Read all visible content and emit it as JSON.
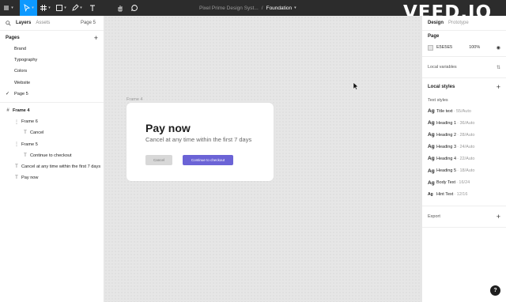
{
  "toolbar": {
    "breadcrumb_project": "Pixel Prime Design Syst...",
    "breadcrumb_separator": "/",
    "breadcrumb_page": "Foundation",
    "watermark": "VEED.IO"
  },
  "left_panel": {
    "tabs": {
      "layers": "Layers",
      "assets": "Assets"
    },
    "current_page": "Page 5",
    "pages_heading": "Pages",
    "pages": [
      {
        "label": "Brand"
      },
      {
        "label": "Typography"
      },
      {
        "label": "Colors"
      },
      {
        "label": "Website"
      },
      {
        "label": "Page 5",
        "current": true
      }
    ],
    "layers": [
      {
        "label": "Frame 4",
        "icon": "frame-icon"
      },
      {
        "label": "Frame 6",
        "icon": "frame-auto-layout-icon"
      },
      {
        "label": "Cancel",
        "icon": "text-icon"
      },
      {
        "label": "Frame 5",
        "icon": "frame-auto-layout-icon"
      },
      {
        "label": "Continue to checkout",
        "icon": "text-icon"
      },
      {
        "label": "Cancel at any time within the first 7 days",
        "icon": "text-icon"
      },
      {
        "label": "Pay now",
        "icon": "text-icon"
      }
    ]
  },
  "canvas": {
    "frame_label": "Frame 4",
    "title": "Pay now",
    "subtitle": "Cancel at any time within the first 7 days",
    "cancel_button": "Cancel",
    "continue_button": "Continue to checkout",
    "accent_color": "#6b63d6",
    "canvas_bg": "#e5e5e5"
  },
  "right_panel": {
    "tabs": {
      "design": "Design",
      "prototype": "Prototype"
    },
    "page_heading": "Page",
    "bg_hex": "E5E5E5",
    "bg_opacity": "100%",
    "local_variables": "Local variables",
    "local_styles": "Local styles",
    "text_styles_label": "Text styles",
    "text_styles": [
      {
        "ag": "Ag",
        "name": "Title text",
        "meta": "· 55/Auto"
      },
      {
        "ag": "Ag",
        "name": "Heading 1",
        "meta": "· 36/Auto"
      },
      {
        "ag": "Ag",
        "name": "Heading 2",
        "meta": "· 28/Auto"
      },
      {
        "ag": "Ag",
        "name": "Heading 3",
        "meta": "· 24/Auto"
      },
      {
        "ag": "Ag",
        "name": "Heading 4",
        "meta": "· 22/Auto"
      },
      {
        "ag": "Ag",
        "name": "Heading 5",
        "meta": "· 18/Auto"
      },
      {
        "ag": "Ag",
        "name": "Body Text",
        "meta": "· 16/24"
      },
      {
        "ag": "Ag",
        "name": "Hint Text",
        "meta": "· 12/16"
      }
    ],
    "export_label": "Export",
    "help": "?"
  }
}
